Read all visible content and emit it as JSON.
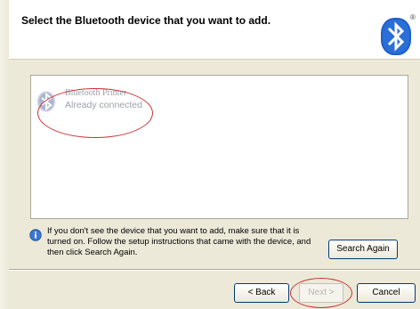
{
  "header": {
    "title": "Select the Bluetooth device that you want to add.",
    "logo_icon": "bluetooth-logo-icon",
    "registered_mark": "®"
  },
  "device_list": {
    "items": [
      {
        "name": "Bluetooth Printer",
        "status": "Already connected",
        "icon": "bluetooth-device-icon",
        "enabled": false
      }
    ]
  },
  "info": {
    "icon": "info-icon",
    "text": "If you don't see the device that you want to add, make sure that it is turned on. Follow the setup instructions that came with the device, and then click Search Again."
  },
  "buttons": {
    "search_again": "Search Again",
    "back": "< Back",
    "next": "Next >",
    "cancel": "Cancel"
  },
  "colors": {
    "dialog_bg": "#ece9d8",
    "annotation_red": "#c93030",
    "disabled_text": "#9ca0ad"
  }
}
